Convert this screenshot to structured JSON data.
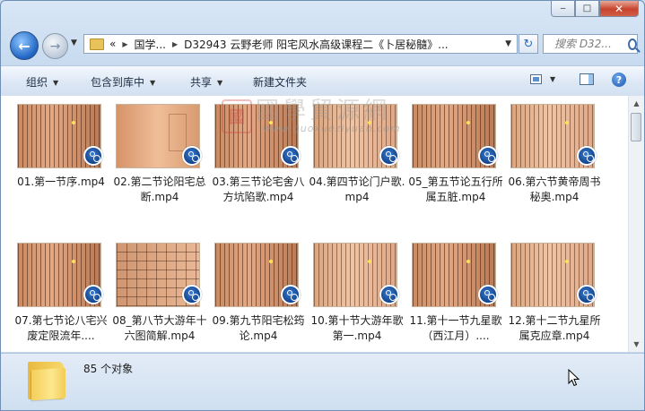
{
  "window": {
    "caption": {
      "minimize": "‒",
      "maximize": "□",
      "close": "✕"
    }
  },
  "navigation": {
    "back_glyph": "←",
    "forward_glyph": "→",
    "address": {
      "prefix": "«",
      "segments": [
        "国学...",
        "D32943  云野老师 阳宅风水高级课程二《卜居秘髓》..."
      ]
    },
    "refresh_glyph": "↻",
    "search_placeholder": "搜索 D32..."
  },
  "toolbar": {
    "organize": "组织",
    "include_in_library": "包含到库中",
    "share": "共享",
    "new_folder": "新建文件夹",
    "help_glyph": "?"
  },
  "files": [
    {
      "name": "01.第一节序.mp4",
      "thumb": "dark"
    },
    {
      "name": "02.第二节论阳宅总断.mp4",
      "thumb": "plain"
    },
    {
      "name": "03.第三节论宅舍八方坑陷歌.mp4",
      "thumb": "dark"
    },
    {
      "name": "04.第四节论门户歌.mp4",
      "thumb": "light"
    },
    {
      "name": "05_第五节论五行所属五脏.mp4",
      "thumb": "dark"
    },
    {
      "name": "06.第六节黄帝周书秘奥.mp4",
      "thumb": "light"
    },
    {
      "name": "07.第七节论八宅兴废定限流年....",
      "thumb": "dark"
    },
    {
      "name": "08_第八节大游年十六图简解.mp4",
      "thumb": "table"
    },
    {
      "name": "09.第九节阳宅松筠论.mp4",
      "thumb": "dark"
    },
    {
      "name": "10.第十节大游年歌第一.mp4",
      "thumb": "light"
    },
    {
      "name": "11.第十一节九星歌（西江月）....",
      "thumb": "dark"
    },
    {
      "name": "12.第十二节九星所属克应章.mp4",
      "thumb": "light"
    }
  ],
  "watermark": {
    "seal": "國",
    "title": "國學貿源網",
    "url": "www.guoxueziyuan.com"
  },
  "status": {
    "item_count": "85 个对象"
  },
  "colors": {
    "accent": "#1f64c2",
    "toolbar_text": "#1e2d44",
    "close_button": "#c8432c"
  }
}
